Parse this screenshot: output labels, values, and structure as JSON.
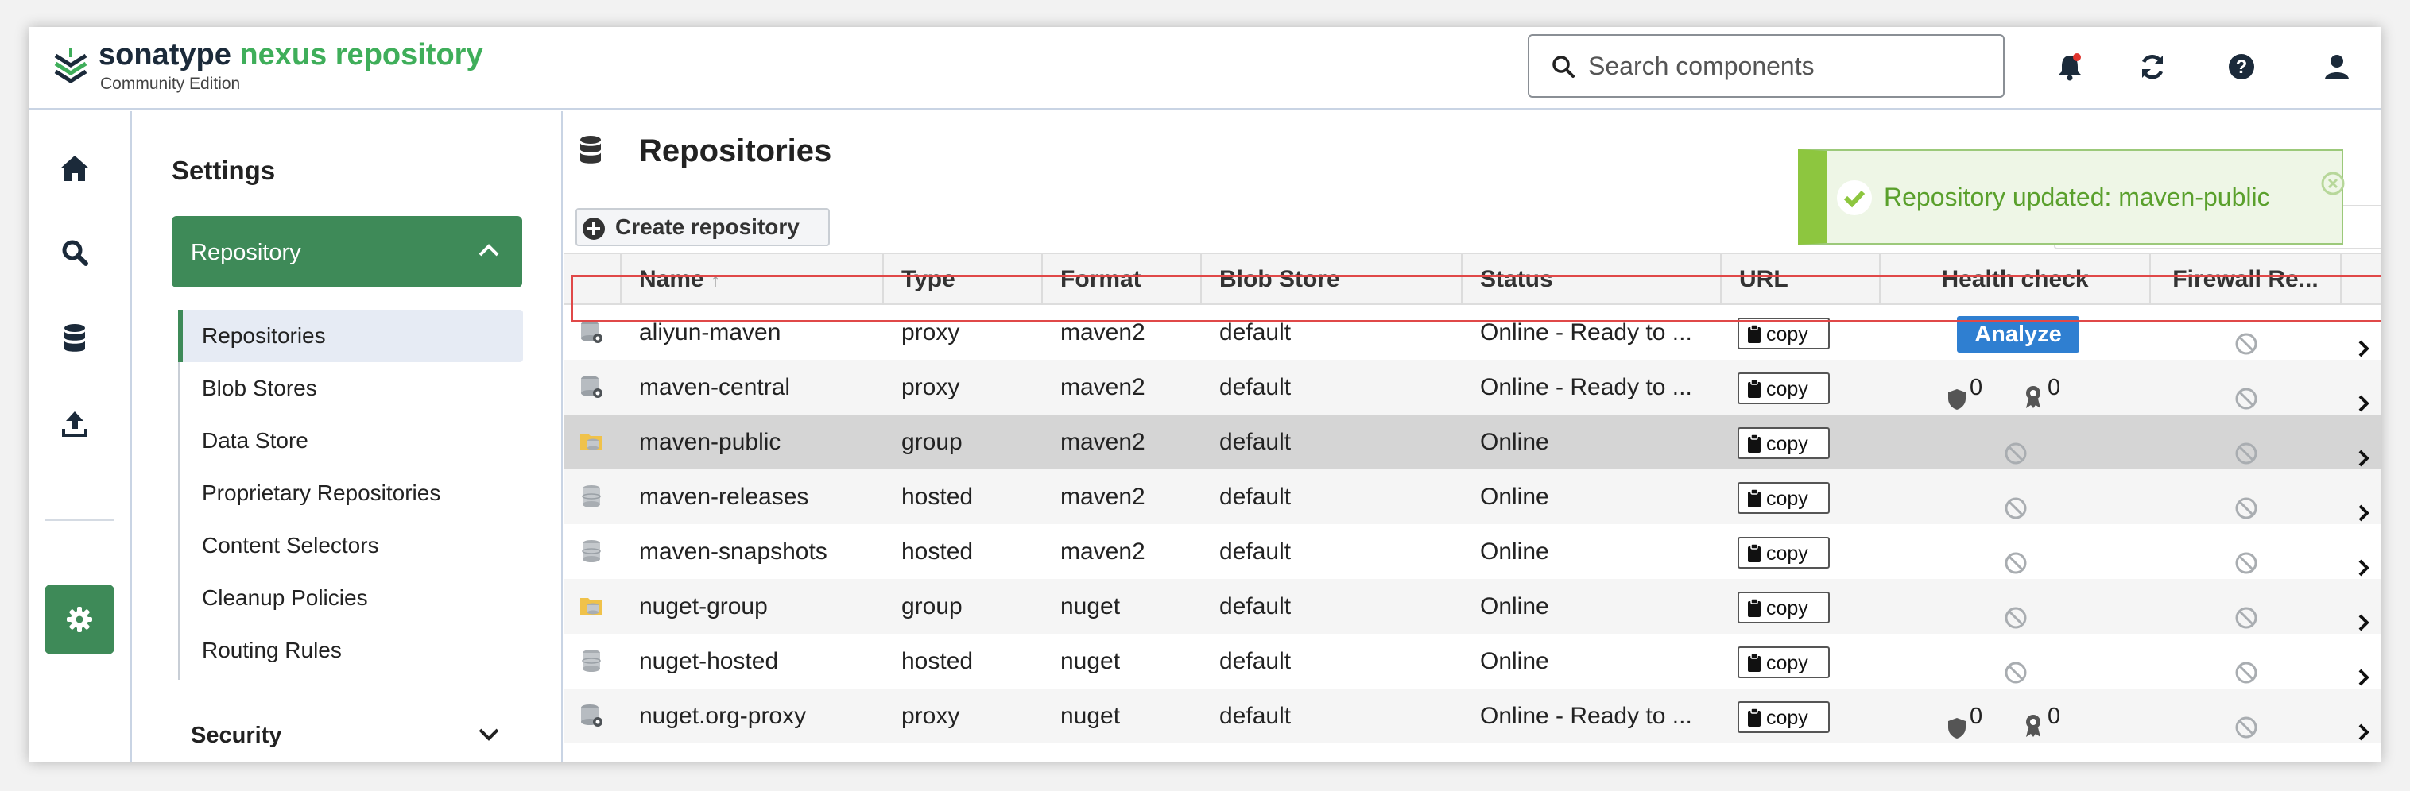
{
  "header": {
    "brand_part1": "sonatype",
    "brand_part2": "nexus repository",
    "edition": "Community Edition",
    "search_placeholder": "Search components"
  },
  "sidebar": {
    "title": "Settings",
    "section": "Repository",
    "items": [
      {
        "label": "Repositories",
        "selected": true
      },
      {
        "label": "Blob Stores"
      },
      {
        "label": "Data Store"
      },
      {
        "label": "Proprietary Repositories"
      },
      {
        "label": "Content Selectors"
      },
      {
        "label": "Cleanup Policies"
      },
      {
        "label": "Routing Rules"
      }
    ],
    "security": "Security"
  },
  "main": {
    "title": "Repositories",
    "create_button": "Create repository",
    "columns": {
      "name": "Name",
      "type": "Type",
      "format": "Format",
      "blob": "Blob Store",
      "status": "Status",
      "url": "URL",
      "health": "Health check",
      "firewall": "Firewall Re..."
    },
    "copy_label": "copy",
    "analyze_label": "Analyze",
    "rows": [
      {
        "name": "aliyun-maven",
        "type": "proxy",
        "format": "maven2",
        "blob": "default",
        "status": "Online - Ready to ...",
        "health": "analyze"
      },
      {
        "name": "maven-central",
        "type": "proxy",
        "format": "maven2",
        "blob": "default",
        "status": "Online - Ready to ...",
        "health": "counts",
        "count1": "0",
        "count2": "0"
      },
      {
        "name": "maven-public",
        "type": "group",
        "format": "maven2",
        "blob": "default",
        "status": "Online",
        "health": "none"
      },
      {
        "name": "maven-releases",
        "type": "hosted",
        "format": "maven2",
        "blob": "default",
        "status": "Online",
        "health": "none"
      },
      {
        "name": "maven-snapshots",
        "type": "hosted",
        "format": "maven2",
        "blob": "default",
        "status": "Online",
        "health": "none"
      },
      {
        "name": "nuget-group",
        "type": "group",
        "format": "nuget",
        "blob": "default",
        "status": "Online",
        "health": "none"
      },
      {
        "name": "nuget-hosted",
        "type": "hosted",
        "format": "nuget",
        "blob": "default",
        "status": "Online",
        "health": "none"
      },
      {
        "name": "nuget.org-proxy",
        "type": "proxy",
        "format": "nuget",
        "blob": "default",
        "status": "Online - Ready to ...",
        "health": "counts",
        "count1": "0",
        "count2": "0"
      }
    ]
  },
  "toast": {
    "message": "Repository updated: maven-public"
  },
  "colors": {
    "brand_green": "#3fae5a",
    "active_green": "#3e8a58",
    "analyze_blue": "#2f7fd1",
    "toast_green": "#8dc63f",
    "highlight_red": "#e04848"
  }
}
